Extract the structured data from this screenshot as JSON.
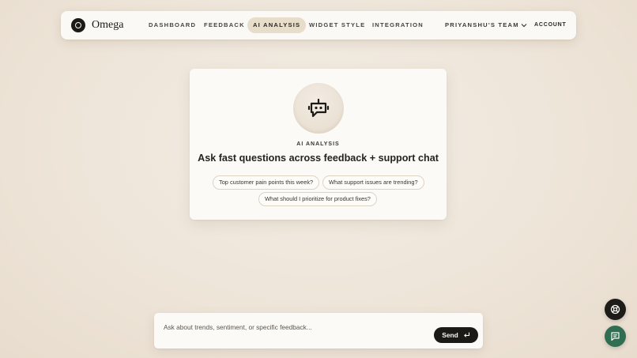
{
  "brand": {
    "name": "Omega",
    "logo_icon": "omega-ring-icon"
  },
  "nav": {
    "items": [
      {
        "label": "DASHBOARD",
        "active": false
      },
      {
        "label": "FEEDBACK",
        "active": false
      },
      {
        "label": "AI ANALYSIS",
        "active": true
      },
      {
        "label": "WIDGET STYLE",
        "active": false
      },
      {
        "label": "INTEGRATION",
        "active": false
      }
    ],
    "team": "PRIYANSHU'S TEAM",
    "account": "ACCOUNT"
  },
  "hero": {
    "icon": "bot-icon",
    "eyebrow": "AI ANALYSIS",
    "headline": "Ask fast questions across feedback + support chat",
    "suggestions": [
      "Top customer pain points this week?",
      "What support issues are trending?",
      "What should I prioritize for product fixes?"
    ]
  },
  "composer": {
    "placeholder": "Ask about trends, sentiment, or specific feedback...",
    "value": "",
    "send_label": "Send"
  },
  "floating_buttons": [
    "support-icon",
    "chat-icon"
  ],
  "colors": {
    "accent_dark": "#1c1a17",
    "active_tab": "#e8dccb",
    "chat_fab": "#2f6e53",
    "background": "#efe6da"
  }
}
